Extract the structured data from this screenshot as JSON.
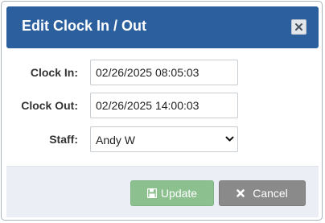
{
  "dialog": {
    "title": "Edit Clock In / Out",
    "close_icon": "close-icon",
    "header_color": "#2b5f9e"
  },
  "form": {
    "clock_in": {
      "label": "Clock In:",
      "value": "02/26/2025 08:05:03"
    },
    "clock_out": {
      "label": "Clock Out:",
      "value": "02/26/2025 14:00:03"
    },
    "staff": {
      "label": "Staff:",
      "selected": "Andy W"
    }
  },
  "footer": {
    "update": {
      "label": "Update",
      "icon": "save-icon",
      "color": "#8cc18f"
    },
    "cancel": {
      "label": "Cancel",
      "icon": "close-icon",
      "color": "#8a8a8a"
    }
  }
}
